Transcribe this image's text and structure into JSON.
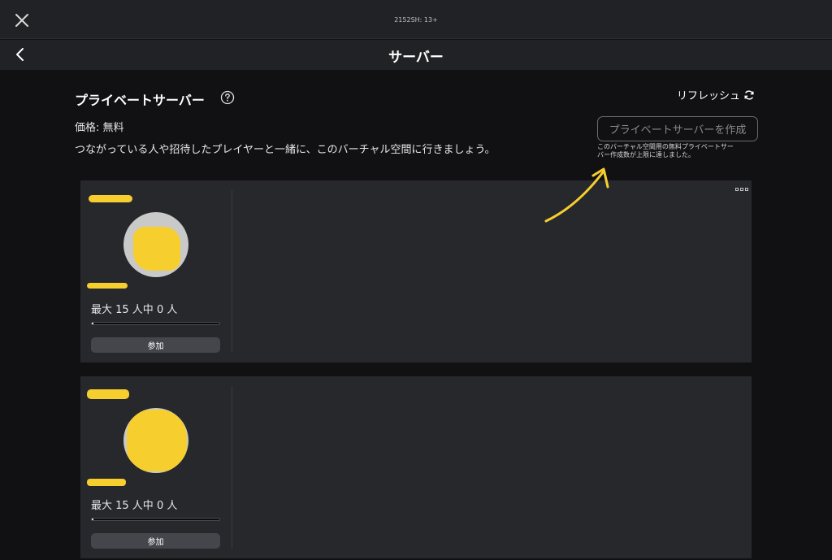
{
  "header": {
    "device_label": "2152SH: 13+",
    "title": "サーバー"
  },
  "main": {
    "section_title": "プライベートサーバー",
    "price": "価格: 無料",
    "description": "つながっている人や招待したプレイヤーと一緒に、このバーチャル空間に行きましょう。",
    "refresh_label": "リフレッシュ",
    "create_button": "プライベートサーバーを作成",
    "limit_note_line1": "このバーチャル空間用の無料プライベートサー",
    "limit_note_line2": "バー作成数が上限に達しました。"
  },
  "servers": [
    {
      "capacity_text": "最大 15 人中 0 人",
      "occupancy_fraction": 0.0,
      "join_label": "参加"
    },
    {
      "capacity_text": "最大 15 人中 0 人",
      "occupancy_fraction": 0.0,
      "join_label": "参加"
    }
  ],
  "colors": {
    "background": "#111114",
    "card": "#27282c",
    "redaction": "#f6cf2e",
    "annotation_arrow": "#f6cf2e"
  },
  "icons": [
    "close-icon",
    "chevron-left-icon",
    "help-icon",
    "refresh-icon",
    "more-menu-icon"
  ]
}
